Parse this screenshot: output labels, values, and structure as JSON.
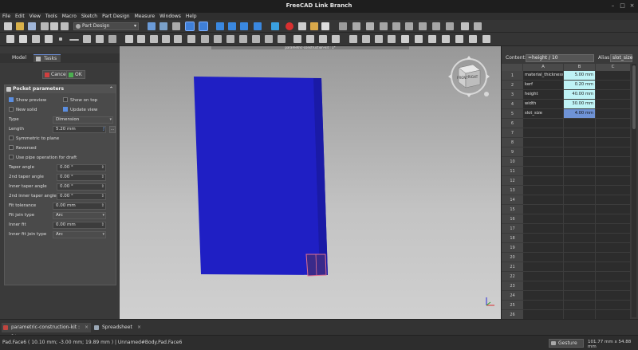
{
  "app": {
    "title": "FreeCAD Link Branch"
  },
  "menu": [
    "File",
    "Edit",
    "View",
    "Tools",
    "Macro",
    "Sketch",
    "Part Design",
    "Measure",
    "Windows",
    "Help"
  ],
  "toolbar": {
    "workbench": "Part Design"
  },
  "left_panel": {
    "tabs": [
      "Model",
      "Tasks"
    ],
    "cancel_label": "Cancel",
    "ok_label": "OK",
    "panel_title": "Pocket parameters",
    "show_preview": "Show preview",
    "show_on_top": "Show on top",
    "new_solid": "New solid",
    "update_view": "Update view",
    "type_label": "Type",
    "type_value": "Dimension",
    "length_label": "Length",
    "length_value": "5.20 mm",
    "symmetric": "Symmetric to plane",
    "reversed": "Reversed",
    "pipe": "Use pipe operation for draft",
    "taper_label": "Taper angle",
    "taper_value": "0.00 °",
    "taper2_label": "2nd taper angle",
    "taper2_value": "0.00 °",
    "inner_taper_label": "Inner taper angle",
    "inner_taper_value": "0.00 °",
    "inner_taper2_label": "2nd inner taper angle",
    "inner_taper2_value": "0.00 °",
    "fit_tol_label": "Fit tolerance",
    "fit_tol_value": "0.00 mm",
    "fit_join_label": "Fit join type",
    "fit_join_value": "Arc",
    "inner_fit_label": "Inner fit",
    "inner_fit_value": "0.00 mm",
    "inner_fit_join_label": "Inner fit join type",
    "inner_fit_join_value": "Arc"
  },
  "viewport": {
    "doc_label": "parametric-construction-kit : 1*",
    "nav_front": "FRONT",
    "nav_right": "RIGHT"
  },
  "spreadsheet": {
    "content_label": "Content:",
    "content_value": "=height / 10",
    "alias_label": "Alias:",
    "alias_value": "slot_size",
    "columns": [
      "A",
      "B",
      "C"
    ],
    "rows": [
      {
        "num": "1",
        "a": "material_thickness",
        "b": "5.00 mm"
      },
      {
        "num": "2",
        "a": "kerf",
        "b": "0.20 mm"
      },
      {
        "num": "3",
        "a": "height",
        "b": "40.00 mm"
      },
      {
        "num": "4",
        "a": "width",
        "b": "30.00 mm"
      },
      {
        "num": "5",
        "a": "slot_size",
        "b": "4.00 mm"
      },
      {
        "num": "6",
        "a": "",
        "b": ""
      },
      {
        "num": "7",
        "a": "",
        "b": ""
      },
      {
        "num": "8",
        "a": "",
        "b": ""
      },
      {
        "num": "9",
        "a": "",
        "b": ""
      },
      {
        "num": "10",
        "a": "",
        "b": ""
      },
      {
        "num": "11",
        "a": "",
        "b": ""
      },
      {
        "num": "12",
        "a": "",
        "b": ""
      },
      {
        "num": "13",
        "a": "",
        "b": ""
      },
      {
        "num": "14",
        "a": "",
        "b": ""
      },
      {
        "num": "15",
        "a": "",
        "b": ""
      },
      {
        "num": "16",
        "a": "",
        "b": ""
      },
      {
        "num": "17",
        "a": "",
        "b": ""
      },
      {
        "num": "18",
        "a": "",
        "b": ""
      },
      {
        "num": "19",
        "a": "",
        "b": ""
      },
      {
        "num": "20",
        "a": "",
        "b": ""
      },
      {
        "num": "21",
        "a": "",
        "b": ""
      },
      {
        "num": "22",
        "a": "",
        "b": ""
      },
      {
        "num": "23",
        "a": "",
        "b": ""
      },
      {
        "num": "24",
        "a": "",
        "b": ""
      },
      {
        "num": "25",
        "a": "",
        "b": ""
      },
      {
        "num": "26",
        "a": "",
        "b": ""
      }
    ]
  },
  "doc_tabs": [
    "parametric-construction-kit : 1*",
    "Spreadsheet"
  ],
  "status": {
    "message": "Pad.Face6 ( 10.10 mm; -3.00 mm; 19.89 mm ) | Unnamed#Body.Pad.Face6",
    "nav_style": "Gesture",
    "dimensions": "101.77 mm x 54.88 mm"
  },
  "colors": {
    "accent": "#5b8ee0",
    "solid": "#1f1fc4",
    "cell_value": "#bff3f6",
    "selected_cell": "#6f93d6"
  }
}
